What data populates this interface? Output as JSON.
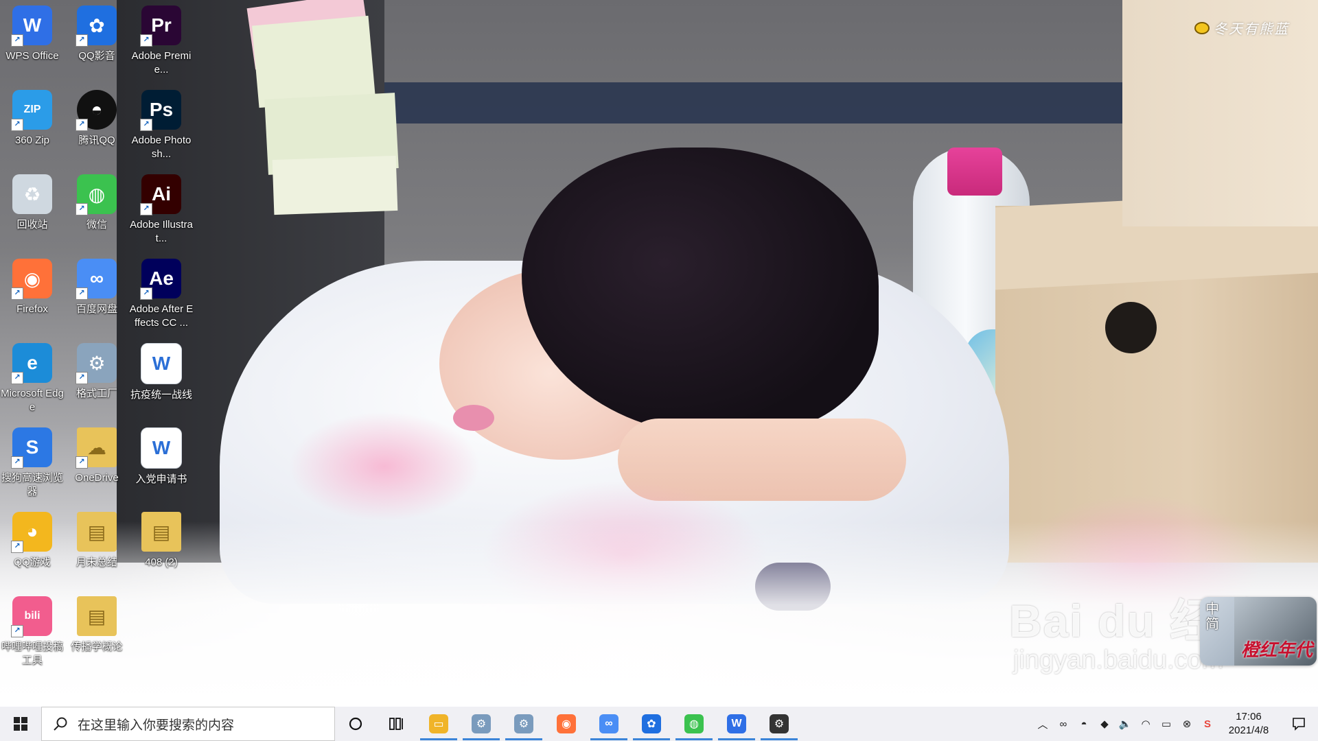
{
  "desktop": {
    "icons": [
      {
        "label": "WPS Office",
        "icon": "wps-office-icon",
        "color": "#2f6fe6"
      },
      {
        "label": "360 Zip",
        "icon": "360-zip-icon",
        "color": "#2b9ce8"
      },
      {
        "label": "回收站",
        "icon": "recycle-bin-icon",
        "color": "#cfd8e0"
      },
      {
        "label": "Firefox",
        "icon": "firefox-icon",
        "color": "#ff7139"
      },
      {
        "label": "Microsoft Edge",
        "icon": "edge-icon",
        "color": "#1c8cd8"
      },
      {
        "label": "搜狗高速浏览器",
        "icon": "sogou-browser-icon",
        "color": "#2c78e4"
      },
      {
        "label": "QQ游戏",
        "icon": "qq-game-icon",
        "color": "#f3b71e"
      },
      {
        "label": "哔哩哔哩投稿工具",
        "icon": "bilibili-icon",
        "color": "#f25d8e"
      },
      {
        "label": "QQ影音",
        "icon": "qq-player-icon",
        "color": "#1f6fe0"
      },
      {
        "label": "腾讯QQ",
        "icon": "qq-icon",
        "color": "#111111"
      },
      {
        "label": "微信",
        "icon": "wechat-icon",
        "color": "#3bc24f"
      },
      {
        "label": "百度网盘",
        "icon": "baidu-netdisk-icon",
        "color": "#4a8ef5"
      },
      {
        "label": "格式工厂",
        "icon": "format-factory-icon",
        "color": "#8aa4bd"
      },
      {
        "label": "OneDrive",
        "icon": "onedrive-folder-icon",
        "color": "#e8c35a"
      },
      {
        "label": "月末总结",
        "icon": "folder-icon",
        "color": "#e8c35a"
      },
      {
        "label": "传播学概论",
        "icon": "folder-icon",
        "color": "#e8c35a"
      },
      {
        "label": "Adobe Premie...",
        "icon": "premiere-icon",
        "color": "#2a0634"
      },
      {
        "label": "Adobe Photosh...",
        "icon": "photoshop-icon",
        "color": "#001d34"
      },
      {
        "label": "Adobe Illustrat...",
        "icon": "illustrator-icon",
        "color": "#330000"
      },
      {
        "label": "Adobe After Effects CC ...",
        "icon": "after-effects-icon",
        "color": "#00005b"
      },
      {
        "label": "抗疫统一战线",
        "icon": "word-doc-icon",
        "color": "#ffffff"
      },
      {
        "label": "入党申请书",
        "icon": "word-doc-icon",
        "color": "#ffffff"
      },
      {
        "label": "408 (2)",
        "icon": "folder-icon",
        "color": "#e8c35a"
      }
    ],
    "icon_glyphs": {
      "wps-office-icon": "W",
      "360-zip-icon": "ZIP",
      "recycle-bin-icon": "♻",
      "firefox-icon": "◉",
      "edge-icon": "e",
      "sogou-browser-icon": "S",
      "qq-game-icon": "◕",
      "bilibili-icon": "bili",
      "qq-player-icon": "✿",
      "qq-icon": "◓",
      "wechat-icon": "◍",
      "baidu-netdisk-icon": "∞",
      "format-factory-icon": "⚙",
      "onedrive-folder-icon": "☁",
      "folder-icon": "▤",
      "premiere-icon": "Pr",
      "photoshop-icon": "Ps",
      "illustrator-icon": "Ai",
      "after-effects-icon": "Ae",
      "word-doc-icon": "W"
    },
    "signature_text": "冬天有熊蓝",
    "watermark": {
      "main": "Bai du 经验",
      "url": "jingyan.baidu.com"
    },
    "ime": {
      "mode_line1": "中",
      "mode_line2": "简",
      "brand": "橙红年代"
    }
  },
  "taskbar": {
    "search_placeholder": "在这里输入你要搜索的内容",
    "pinned_apps": [
      {
        "name": "file-explorer",
        "icon": "file-explorer-icon",
        "color": "#f0b429",
        "glyph": "▭",
        "running": true
      },
      {
        "name": "format-factory",
        "icon": "format-factory-icon",
        "color": "#7a9bbd",
        "glyph": "⚙",
        "running": true
      },
      {
        "name": "format-factory-2",
        "icon": "format-factory-icon",
        "color": "#7a9bbd",
        "glyph": "⚙",
        "running": true
      },
      {
        "name": "firefox",
        "icon": "firefox-icon",
        "color": "#ff7139",
        "glyph": "◉",
        "running": false
      },
      {
        "name": "baidu-netdisk",
        "icon": "baidu-netdisk-icon",
        "color": "#4a8ef5",
        "glyph": "∞",
        "running": true
      },
      {
        "name": "qq-player",
        "icon": "qq-player-icon",
        "color": "#1f6fe0",
        "glyph": "✿",
        "running": true
      },
      {
        "name": "wechat",
        "icon": "wechat-icon",
        "color": "#3bc24f",
        "glyph": "◍",
        "running": true
      },
      {
        "name": "wps-office",
        "icon": "wps-office-icon",
        "color": "#2f6fe6",
        "glyph": "W",
        "running": true
      },
      {
        "name": "settings",
        "icon": "settings-gear-icon",
        "color": "#333333",
        "glyph": "⚙",
        "running": true
      }
    ],
    "tray_icons": [
      {
        "name": "show-hidden-icons",
        "glyph": "︿"
      },
      {
        "name": "baidu-netdisk-tray-icon",
        "glyph": "∞"
      },
      {
        "name": "qq-tray-icon",
        "glyph": "◓"
      },
      {
        "name": "dropbox-tray-icon",
        "glyph": "◆"
      },
      {
        "name": "volume-icon",
        "glyph": "🔈"
      },
      {
        "name": "wifi-icon",
        "glyph": "◠"
      },
      {
        "name": "battery-icon",
        "glyph": "▭"
      },
      {
        "name": "network-disabled-icon",
        "glyph": "⊗"
      },
      {
        "name": "sogou-ime-tray-icon",
        "glyph": "S"
      }
    ],
    "clock": {
      "time": "17:06",
      "date": "2021/4/8"
    }
  }
}
